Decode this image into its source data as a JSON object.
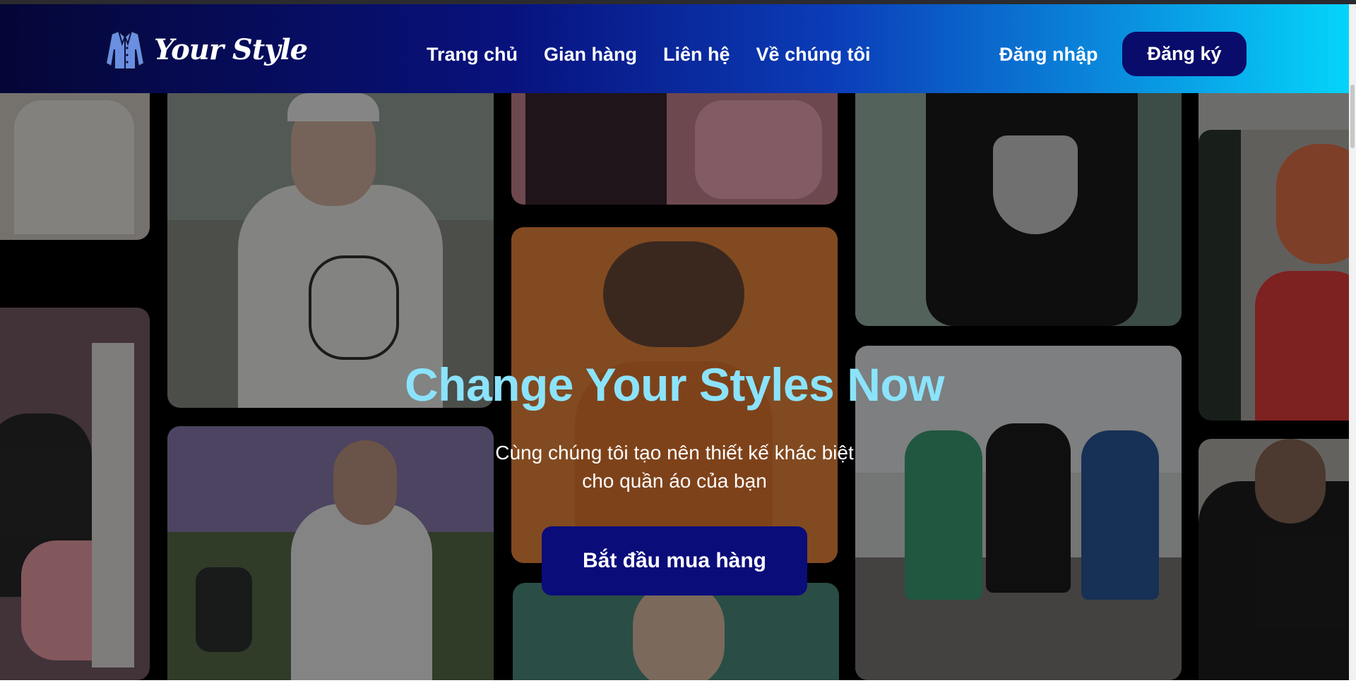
{
  "brand": {
    "name": "Your Style",
    "icon": "jacket-icon"
  },
  "nav": {
    "items": [
      {
        "label": "Trang chủ"
      },
      {
        "label": "Gian hàng"
      },
      {
        "label": "Liên hệ"
      },
      {
        "label": "Về chúng tôi"
      }
    ]
  },
  "auth": {
    "login_label": "Đăng nhập",
    "signup_label": "Đăng ký"
  },
  "hero": {
    "headline": "Change Your Styles Now",
    "subtitle_line1": "Cùng chúng tôi tạo nên thiết kế khác biệt",
    "subtitle_line2": "cho quần áo của bạn",
    "cta_label": "Bắt đầu mua hàng"
  },
  "colors": {
    "header_gradient": [
      "#050636",
      "#08127e",
      "#0b3db8",
      "#0a89dc",
      "#05d4fb"
    ],
    "signup_button": "#0a0c6b",
    "headline": "#8be3fb",
    "cta_button": "#0a0c7a"
  }
}
